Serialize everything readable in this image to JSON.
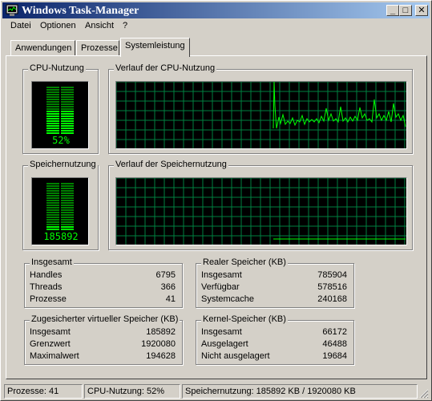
{
  "window": {
    "title": "Windows Task-Manager",
    "controls": {
      "minimize": "_",
      "maximize": "□",
      "close": "✕"
    }
  },
  "menu": [
    "Datei",
    "Optionen",
    "Ansicht",
    "?"
  ],
  "tabs": [
    {
      "label": "Anwendungen",
      "active": false
    },
    {
      "label": "Prozesse",
      "active": false
    },
    {
      "label": "Systemleistung",
      "active": true
    }
  ],
  "cpu_usage": {
    "title": "CPU-Nutzung",
    "value_text": "52%",
    "level": 0.52
  },
  "cpu_history": {
    "title": "Verlauf der CPU-Nutzung"
  },
  "memory_usage": {
    "title": "Speichernutzung",
    "value_text": "185892",
    "level": 0.1
  },
  "memory_history": {
    "title": "Verlauf der Speichernutzung"
  },
  "totals": {
    "title": "Insgesamt",
    "rows": [
      {
        "label": "Handles",
        "value": "6795"
      },
      {
        "label": "Threads",
        "value": "366"
      },
      {
        "label": "Prozesse",
        "value": "41"
      }
    ]
  },
  "physical_memory": {
    "title": "Realer Speicher (KB)",
    "rows": [
      {
        "label": "Insgesamt",
        "value": "785904"
      },
      {
        "label": "Verfügbar",
        "value": "578516"
      },
      {
        "label": "Systemcache",
        "value": "240168"
      }
    ]
  },
  "commit_charge": {
    "title": "Zugesicherter virtueller Speicher (KB)",
    "rows": [
      {
        "label": "Insgesamt",
        "value": "185892"
      },
      {
        "label": "Grenzwert",
        "value": "1920080"
      },
      {
        "label": "Maximalwert",
        "value": "194628"
      }
    ]
  },
  "kernel_memory": {
    "title": "Kernel-Speicher (KB)",
    "rows": [
      {
        "label": "Insgesamt",
        "value": "66172"
      },
      {
        "label": "Ausgelagert",
        "value": "46488"
      },
      {
        "label": "Nicht ausgelagert",
        "value": "19684"
      }
    ]
  },
  "statusbar": {
    "processes": "Prozesse: 41",
    "cpu": "CPU-Nutzung: 52%",
    "memory": "Speichernutzung: 185892 KB / 1920080 KB"
  },
  "colors": {
    "graph_grid": "#008040",
    "graph_line": "#00ff00",
    "meter_on": "#00ff00",
    "meter_off": "#008000",
    "title_start": "#0a246a",
    "title_end": "#a6caf0"
  }
}
